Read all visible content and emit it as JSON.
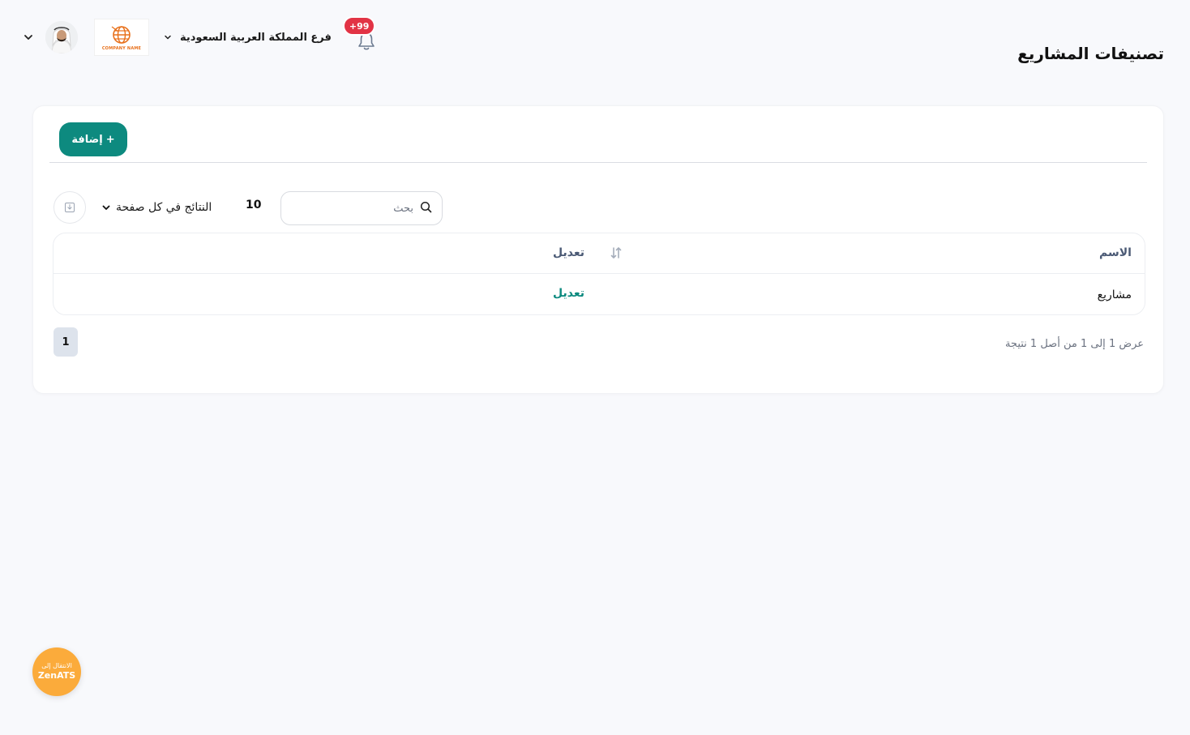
{
  "header": {
    "page_title": "تصنيفات المشاريع",
    "branch_label": "فرع المملكة العربية السعودية",
    "notification_count": "+99",
    "company_logo_text": "COMPANY NAME"
  },
  "toolbar": {
    "add_label": "إضافة",
    "add_icon": "+",
    "search_placeholder": "بحث",
    "per_page_value": "10",
    "per_page_label": "النتائج في كل صفحة"
  },
  "table": {
    "columns": [
      "الاسم",
      "تعديل"
    ],
    "rows": [
      {
        "name": "مشاريع",
        "action": "تعديل"
      }
    ]
  },
  "pagination": {
    "current_page": "1",
    "results_info": "عرض 1 إلى 1 من أصل 1 نتيجة"
  },
  "floating": {
    "top_text": "الانتقال إلى",
    "main_text": "ZenATS"
  },
  "colors": {
    "accent": "#0d8a7f",
    "badge": "#e23345",
    "floating": "#fbab3b"
  }
}
